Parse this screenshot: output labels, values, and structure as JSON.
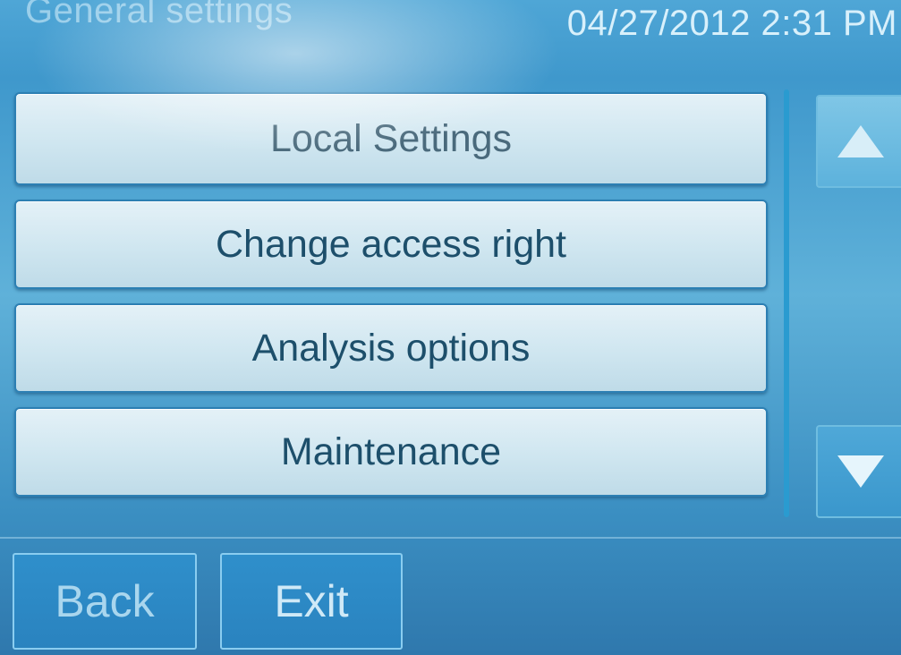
{
  "header": {
    "title": "General settings",
    "datetime": "04/27/2012 2:31 PM"
  },
  "menu": {
    "items": [
      {
        "label": "Local Settings"
      },
      {
        "label": "Change access right"
      },
      {
        "label": "Analysis options"
      },
      {
        "label": "Maintenance"
      }
    ]
  },
  "scroll": {
    "up_icon": "triangle-up-icon",
    "down_icon": "triangle-down-icon"
  },
  "footer": {
    "back_label": "Back",
    "exit_label": "Exit"
  },
  "colors": {
    "screen_bg": "#4fa6d6",
    "button_face": "#cfe6f0",
    "button_text": "#1d4f6b",
    "footer_button": "#2f8fcb"
  }
}
